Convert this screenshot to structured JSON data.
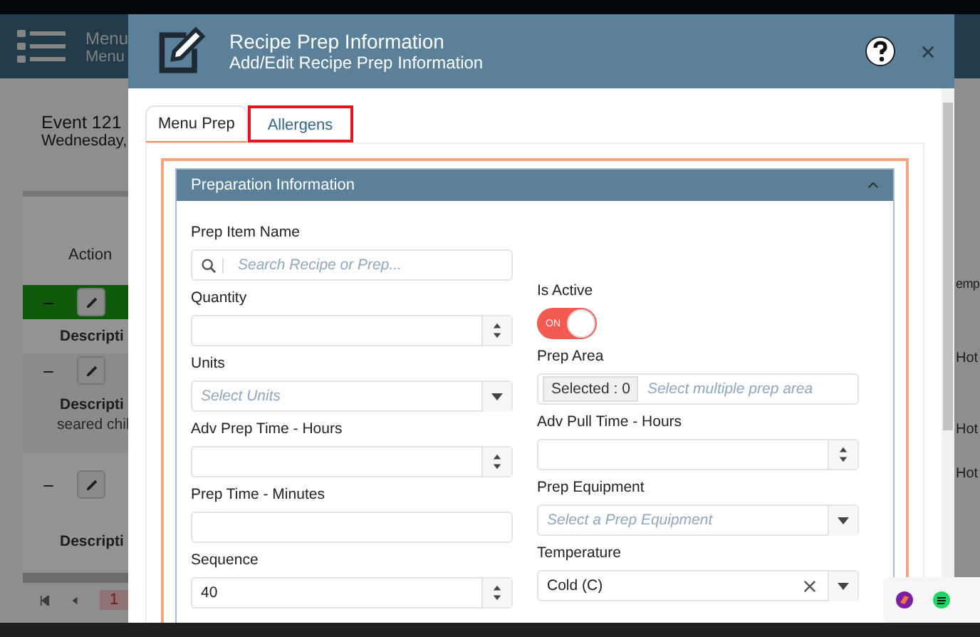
{
  "background": {
    "header": {
      "title": "Menu",
      "subtitle": "Menu"
    },
    "event": {
      "title": "Event 121",
      "date": "Wednesday,"
    },
    "table": {
      "action_header": "Action",
      "cut_header": "emp",
      "rows": [
        {
          "selected": true,
          "expander": "–",
          "label": "Descripti"
        },
        {
          "selected": false,
          "expander": "–",
          "label": "Descripti",
          "description": "seared chil"
        },
        {
          "selected": false,
          "expander": "–",
          "label": "Descripti"
        }
      ],
      "side_cells": [
        "Hot",
        "Hot",
        "Hot"
      ]
    },
    "pagination": {
      "current": "1"
    }
  },
  "modal": {
    "title": "Recipe Prep Information",
    "subtitle": "Add/Edit Recipe Prep Information",
    "tabs": [
      {
        "label": "Menu Prep",
        "selected": true,
        "highlighted": false
      },
      {
        "label": "Allergens",
        "selected": false,
        "highlighted": true
      }
    ],
    "section": {
      "title": "Preparation Information",
      "expanded": true
    },
    "left_fields": [
      {
        "kind": "search",
        "label": "Prep Item Name",
        "placeholder": "Search Recipe or Prep..."
      },
      {
        "kind": "number",
        "label": "Quantity"
      },
      {
        "kind": "select",
        "label": "Units",
        "placeholder": "Select Units"
      },
      {
        "kind": "number",
        "label": "Adv Prep Time - Hours"
      },
      {
        "kind": "text",
        "label": "Prep Time - Minutes"
      },
      {
        "kind": "number",
        "label": "Sequence",
        "value": "40"
      }
    ],
    "right_fields": [
      {
        "kind": "toggle",
        "label": "Is Active",
        "on": true,
        "on_label": "ON"
      },
      {
        "kind": "multiselect",
        "label": "Prep Area",
        "badge": "Selected : 0",
        "placeholder": "Select multiple prep area"
      },
      {
        "kind": "number",
        "label": "Adv Pull Time - Hours"
      },
      {
        "kind": "select",
        "label": "Prep Equipment",
        "placeholder": "Select a Prep Equipment"
      },
      {
        "kind": "select",
        "label": "Temperature",
        "value": "Cold (C)",
        "clearable": true
      }
    ]
  }
}
